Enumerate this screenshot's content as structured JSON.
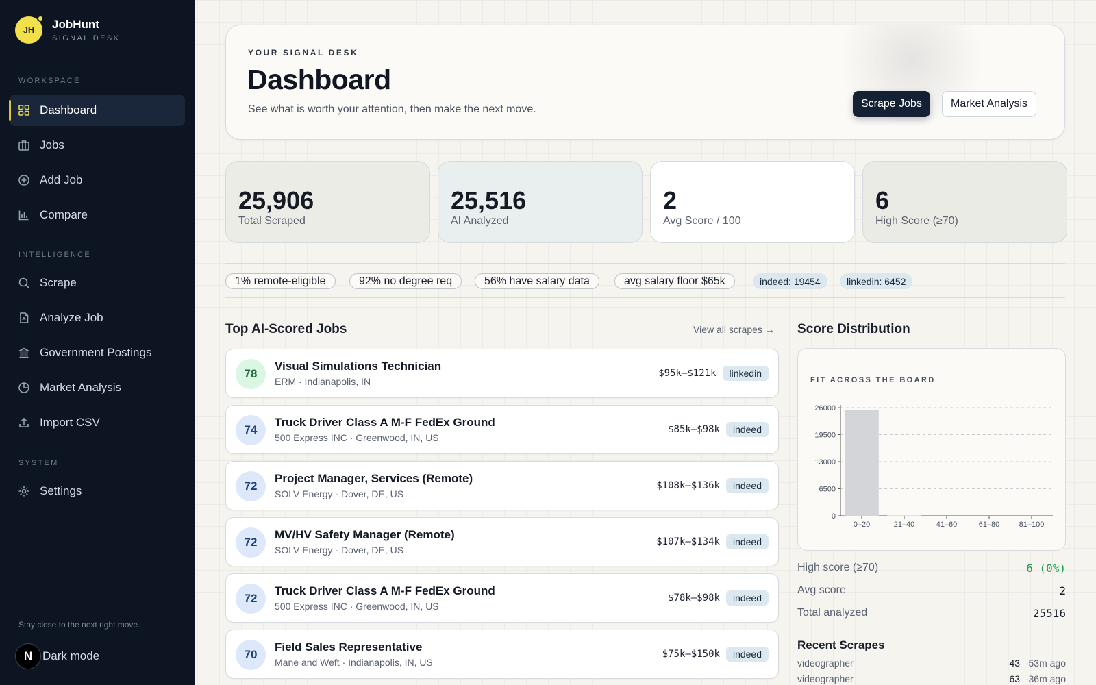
{
  "brand": {
    "initials": "JH",
    "name": "JobHunt",
    "subtitle": "SIGNAL DESK"
  },
  "sidebar": {
    "sections": [
      {
        "title": "WORKSPACE"
      },
      {
        "title": "INTELLIGENCE"
      },
      {
        "title": "SYSTEM"
      }
    ],
    "items": [
      {
        "label": "Dashboard",
        "icon": "grid-icon",
        "active": true
      },
      {
        "label": "Jobs",
        "icon": "briefcase-icon"
      },
      {
        "label": "Add Job",
        "icon": "plus-circle-icon"
      },
      {
        "label": "Compare",
        "icon": "bar-chart-icon"
      },
      {
        "label": "Scrape",
        "icon": "search-icon"
      },
      {
        "label": "Analyze Job",
        "icon": "document-icon"
      },
      {
        "label": "Government Postings",
        "icon": "government-building-icon"
      },
      {
        "label": "Market Analysis",
        "icon": "pie-chart-icon"
      },
      {
        "label": "Import CSV",
        "icon": "upload-icon"
      },
      {
        "label": "Settings",
        "icon": "gear-icon"
      }
    ],
    "footer_tagline": "Stay close to the next right move.",
    "dark_mode_label": "Dark mode",
    "dark_mode_badge": "N"
  },
  "hero": {
    "eyebrow": "YOUR SIGNAL DESK",
    "title": "Dashboard",
    "description": "See what is worth your attention, then make the next move.",
    "primary_button": "Scrape Jobs",
    "secondary_button": "Market Analysis"
  },
  "stats": [
    {
      "value": "25,906",
      "label": "Total Scraped"
    },
    {
      "value": "25,516",
      "label": "AI Analyzed"
    },
    {
      "value": "2",
      "label": "Avg Score / 100"
    },
    {
      "value": "6",
      "label": "High Score (≥70)"
    }
  ],
  "chips": [
    "1% remote-eligible",
    "92% no degree req",
    "56% have salary data",
    "avg salary floor $65k",
    "indeed: 19454",
    "linkedin: 6452"
  ],
  "top_jobs": {
    "title": "Top AI-Scored Jobs",
    "view_all": "View all scrapes →",
    "jobs": [
      {
        "score": "78",
        "title": "Visual Simulations Technician",
        "subtitle": "ERM · Indianapolis, IN",
        "salary": "$95k–$121k",
        "source": "linkedin"
      },
      {
        "score": "74",
        "title": "Truck Driver Class A M-F FedEx Ground",
        "subtitle": "500 Express INC · Greenwood, IN, US",
        "salary": "$85k–$98k",
        "source": "indeed"
      },
      {
        "score": "72",
        "title": "Project Manager, Services (Remote)",
        "subtitle": "SOLV Energy · Dover, DE, US",
        "salary": "$108k–$136k",
        "source": "indeed"
      },
      {
        "score": "72",
        "title": "MV/HV Safety Manager (Remote)",
        "subtitle": "SOLV Energy · Dover, DE, US",
        "salary": "$107k–$134k",
        "source": "indeed"
      },
      {
        "score": "72",
        "title": "Truck Driver Class A M-F FedEx Ground",
        "subtitle": "500 Express INC · Greenwood, IN, US",
        "salary": "$78k–$98k",
        "source": "indeed"
      },
      {
        "score": "70",
        "title": "Field Sales Representative",
        "subtitle": "Mane and Weft · Indianapolis, IN, US",
        "salary": "$75k–$150k",
        "source": "indeed"
      }
    ]
  },
  "distribution": {
    "title": "Score Distribution",
    "eyebrow": "FIT ACROSS THE BOARD",
    "metrics": [
      {
        "label": "High score (≥70)",
        "value": "6 (0%)"
      },
      {
        "label": "Avg score",
        "value": "2"
      },
      {
        "label": "Total analyzed",
        "value": "25516"
      }
    ]
  },
  "chart_data": {
    "type": "bar",
    "categories": [
      "0–20",
      "21–40",
      "41–60",
      "61–80",
      "81–100"
    ],
    "values": [
      25400,
      110,
      0,
      0,
      6
    ],
    "yticks": [
      "0",
      "6500",
      "13000",
      "19500",
      "26000"
    ],
    "ylim": [
      0,
      26000
    ],
    "grid": true,
    "bar_color": "#d3d5d9"
  },
  "recent_scrapes": {
    "title": "Recent Scrapes",
    "items": [
      {
        "query": "videographer",
        "count": "43",
        "ago": "-53m ago"
      },
      {
        "query": "videographer",
        "count": "63",
        "ago": "-36m ago"
      }
    ]
  }
}
